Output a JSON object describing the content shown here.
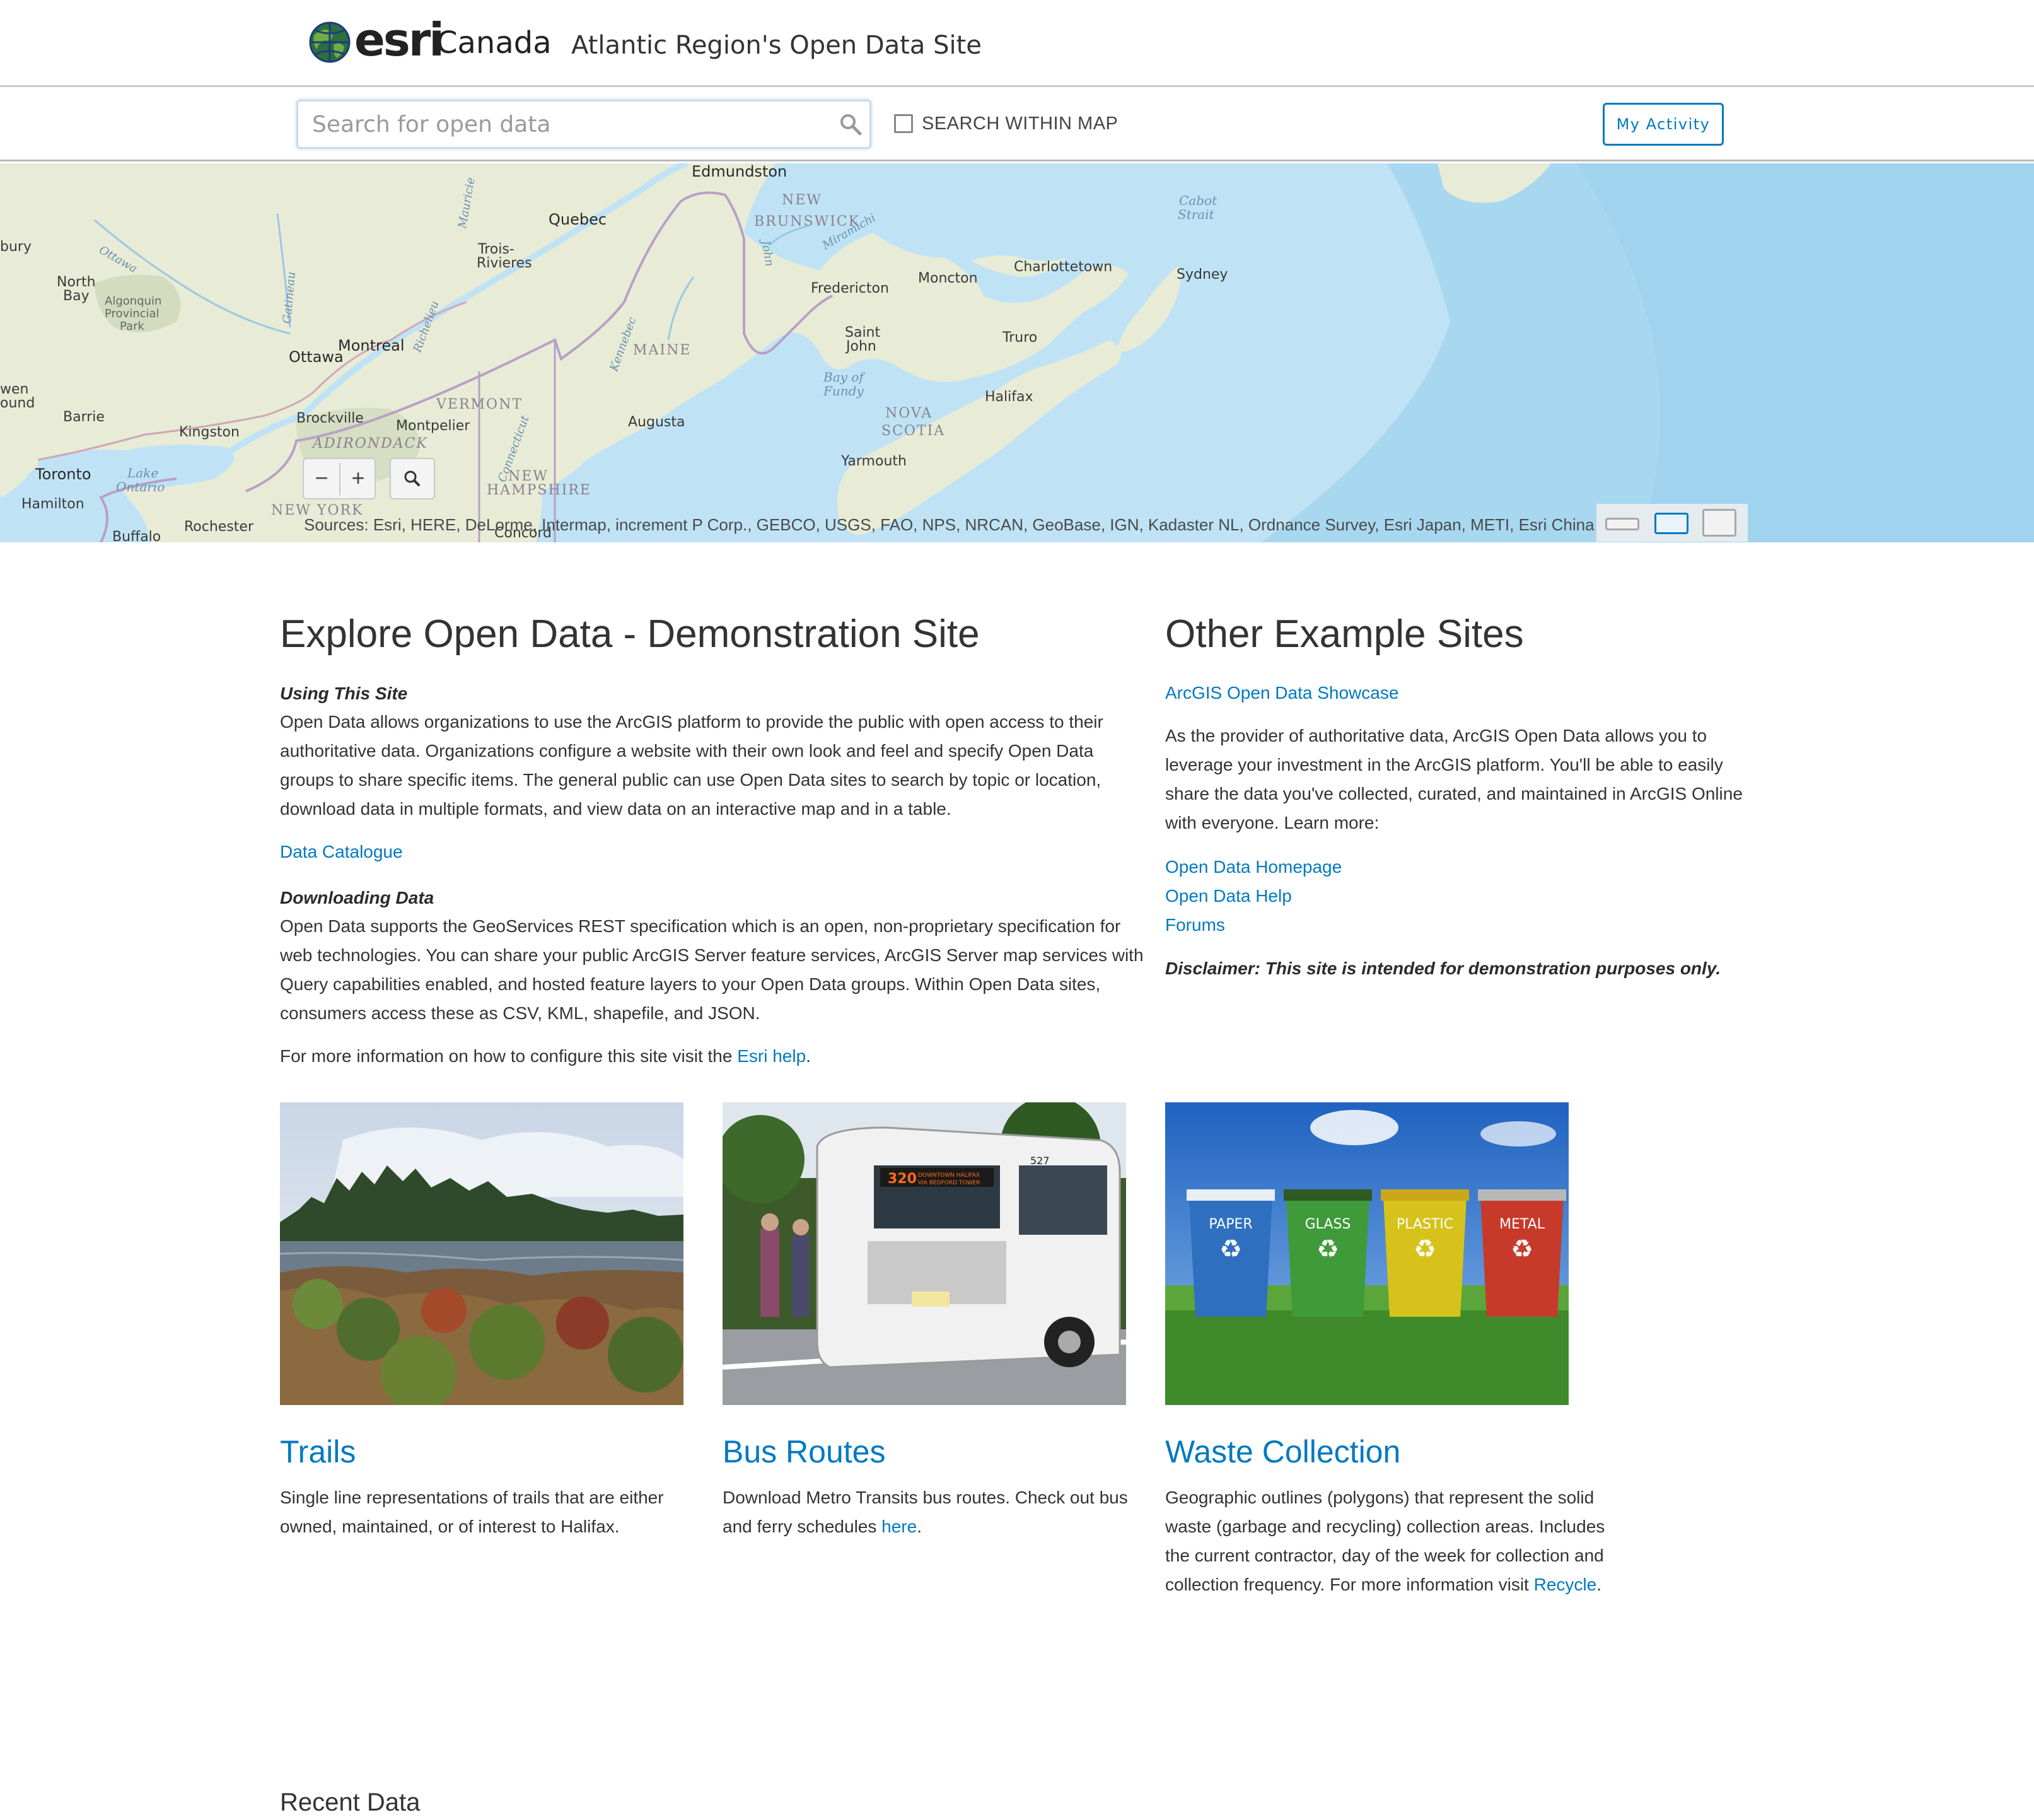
{
  "header": {
    "brand": "esri",
    "brand_suffix": "Canada",
    "site_title": "Atlantic Region's Open Data Site"
  },
  "searchbar": {
    "placeholder": "Search for open data",
    "within_map_label": "SEARCH WITHIN MAP",
    "within_map_checked": false,
    "activity_label": "My Activity"
  },
  "map": {
    "labels": {
      "edmundston": "Edmundston",
      "new_brunswick_1": "NEW",
      "new_brunswick_2": "BRUNSWICK",
      "quebec": "Quebec",
      "trois_rivieres_1": "Trois-",
      "trois_rivieres_2": "Rivieres",
      "north_bay_1": "North",
      "north_bay_2": "Bay",
      "algonquin_1": "Algonquin",
      "algonquin_2": "Provincial",
      "algonquin_3": "Park",
      "bury": "bury",
      "ottawa_river": "Ottawa",
      "ottawa": "Ottawa",
      "montreal": "Montreal",
      "fredericton": "Fredericton",
      "moncton": "Moncton",
      "charlottetown": "Charlottetown",
      "sydney": "Sydney",
      "cabot_1": "Cabot",
      "cabot_2": "Strait",
      "saint_john_1": "Saint",
      "saint_john_2": "John",
      "truro": "Truro",
      "maine": "MAINE",
      "bay_fundy_1": "Bay of",
      "bay_fundy_2": "Fundy",
      "halifax": "Halifax",
      "nova_scotia_1": "NOVA",
      "nova_scotia_2": "SCOTIA",
      "yarmouth": "Yarmouth",
      "augusta": "Augusta",
      "vermont": "VERMONT",
      "montpelier": "Montpelier",
      "brockville": "Brockville",
      "kingston": "Kingston",
      "barrie": "Barrie",
      "wen_1": "wen",
      "wen_2": "ound",
      "adirondack": "ADIRONDACK",
      "toronto": "Toronto",
      "lake_ontario_1": "Lake",
      "lake_ontario_2": "Ontario",
      "hamilton": "Hamilton",
      "new_york": "NEW YORK",
      "rochester": "Rochester",
      "buffalo": "Buffalo",
      "new_hampshire_1": "NEW",
      "new_hampshire_2": "HAMPSHIRE",
      "concord": "Concord",
      "miramichi": "Miramichi",
      "saint_john_river": "John",
      "richelieu": "Richelieu",
      "kennebec": "Kennebec",
      "connecticut": "Connecticut",
      "gatineau": "Gatineau",
      "mauricie": "Mauricie"
    },
    "zoom_out": "−",
    "zoom_in": "+",
    "attribution": "Sources: Esri, HERE, DeLorme, Intermap, increment P Corp., GEBCO, USGS, FAO, NPS, NRCAN, GeoBase, IGN, Kadaster NL, Ordnance Survey, Esri Japan, METI, Esri China (Hong Kong)"
  },
  "explore": {
    "title": "Explore Open Data - Demonstration Site",
    "using_heading": "Using This Site",
    "using_text": "Open Data allows organizations to use the ArcGIS platform to provide the public with open access to their authoritative data. Organizations configure a website with their own look and feel and specify Open Data groups to share specific items. The general public can use Open Data sites to search by topic or location, download data in multiple formats, and view data on an interactive map and in a table.",
    "catalogue_link": "Data Catalogue",
    "downloading_heading": "Downloading Data",
    "downloading_text": "Open Data supports the GeoServices REST specification which is an open, non-proprietary specification for web technologies. You can share your public ArcGIS Server feature services, ArcGIS Server map services with Query capabilities enabled, and hosted feature layers to your Open Data groups. Within Open Data sites, consumers access these as CSV, KML, shapefile, and JSON.",
    "more_info_prefix": "For more information on how to configure this site visit the ",
    "more_info_link": "Esri help",
    "more_info_suffix": "."
  },
  "other": {
    "title": "Other Example Sites",
    "showcase_link": "ArcGIS Open Data Showcase",
    "text": "As the provider of authoritative data, ArcGIS Open Data allows you to leverage your investment in the ArcGIS platform. You'll be able to easily share the data you've collected, curated, and maintained in ArcGIS Online with everyone. Learn more:",
    "links": [
      "Open Data Homepage",
      "Open Data Help",
      "Forums"
    ],
    "disclaimer": "Disclaimer: This site is intended for demonstration purposes only."
  },
  "cards": [
    {
      "title": "Trails",
      "text": "Single line representations of trails that are either owned, maintained, or of interest to Halifax."
    },
    {
      "title": "Bus Routes",
      "text_prefix": "Download Metro Transits bus routes. Check out bus and ferry schedules ",
      "link": "here",
      "text_suffix": ".",
      "sign_number": "320",
      "sign_text_1": "DOWNTOWN HALIFAX",
      "sign_text_2": "VIA BEDFORD TOWER",
      "fleet_number": "527"
    },
    {
      "title": "Waste Collection",
      "text_prefix": "Geographic outlines (polygons) that represent the solid waste (garbage and recycling) collection areas. Includes the current contractor, day of the week for collection and collection frequency. For more information visit ",
      "link": "Recycle",
      "text_suffix": ".",
      "bins": [
        "PAPER",
        "GLASS",
        "PLASTIC",
        "METAL"
      ],
      "recycle_symbol": "♻"
    }
  ],
  "recent": {
    "title": "Recent Data"
  },
  "colors": {
    "link": "#0079c1",
    "text": "#333333",
    "map_water": "#bfe3f5",
    "map_land": "#e9eed9",
    "bin_paper": "#2f6fbf",
    "bin_glass": "#3f9a3a",
    "bin_plastic": "#d6c21a",
    "bin_metal": "#c73a2a"
  },
  "icons": [
    "globe-logo-icon",
    "search-icon",
    "checkbox-icon",
    "zoom-out-icon",
    "zoom-in-icon",
    "map-search-icon",
    "basemap-switch-icon",
    "recycle-icon"
  ]
}
